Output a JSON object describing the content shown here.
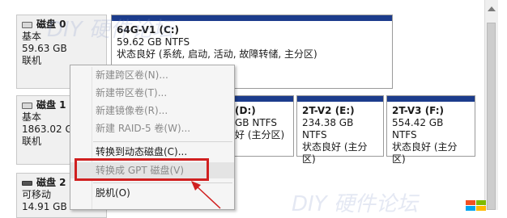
{
  "disks": [
    {
      "title": "磁盘 0",
      "type": "基本",
      "size": "59.63 GB",
      "status": "联机"
    },
    {
      "title": "磁盘 1",
      "type": "基本",
      "size": "1863.02 GB",
      "status": "联机"
    },
    {
      "title": "磁盘 2",
      "type": "可移动",
      "size": "14.91 GB",
      "status": ""
    }
  ],
  "partitions": [
    {
      "name": "64G-V1  (C:)",
      "size": "59.62 GB NTFS",
      "status": "状态良好 (系统, 启动, 活动, 故障转储, 主分区)"
    },
    {
      "name": "(D:)",
      "size": "GB NTFS",
      "status": "好 (主分区)"
    },
    {
      "name": "2T-V2  (E:)",
      "size": "234.38 GB NTFS",
      "status": "状态良好 (主分区)"
    },
    {
      "name": "2T-V3  (F:)",
      "size": "554.42 GB NTFS",
      "status": "状态良好 (主分区)"
    }
  ],
  "context_menu": {
    "new_spanned": "新建跨区卷(N)...",
    "new_striped": "新建带区卷(T)...",
    "new_mirrored": "新建镜像卷(R)...",
    "new_raid5": "新建 RAID-5 卷(W)...",
    "convert_dynamic": "转换到动态磁盘(C)...",
    "convert_gpt": "转换成 GPT 磁盘(V)",
    "offline": "脱机(O)"
  },
  "watermark": "DIY 硬件论坛",
  "colors": {
    "partition_bar": "#1c3c8c",
    "highlight": "#d02020",
    "arrow": "#d02020"
  }
}
